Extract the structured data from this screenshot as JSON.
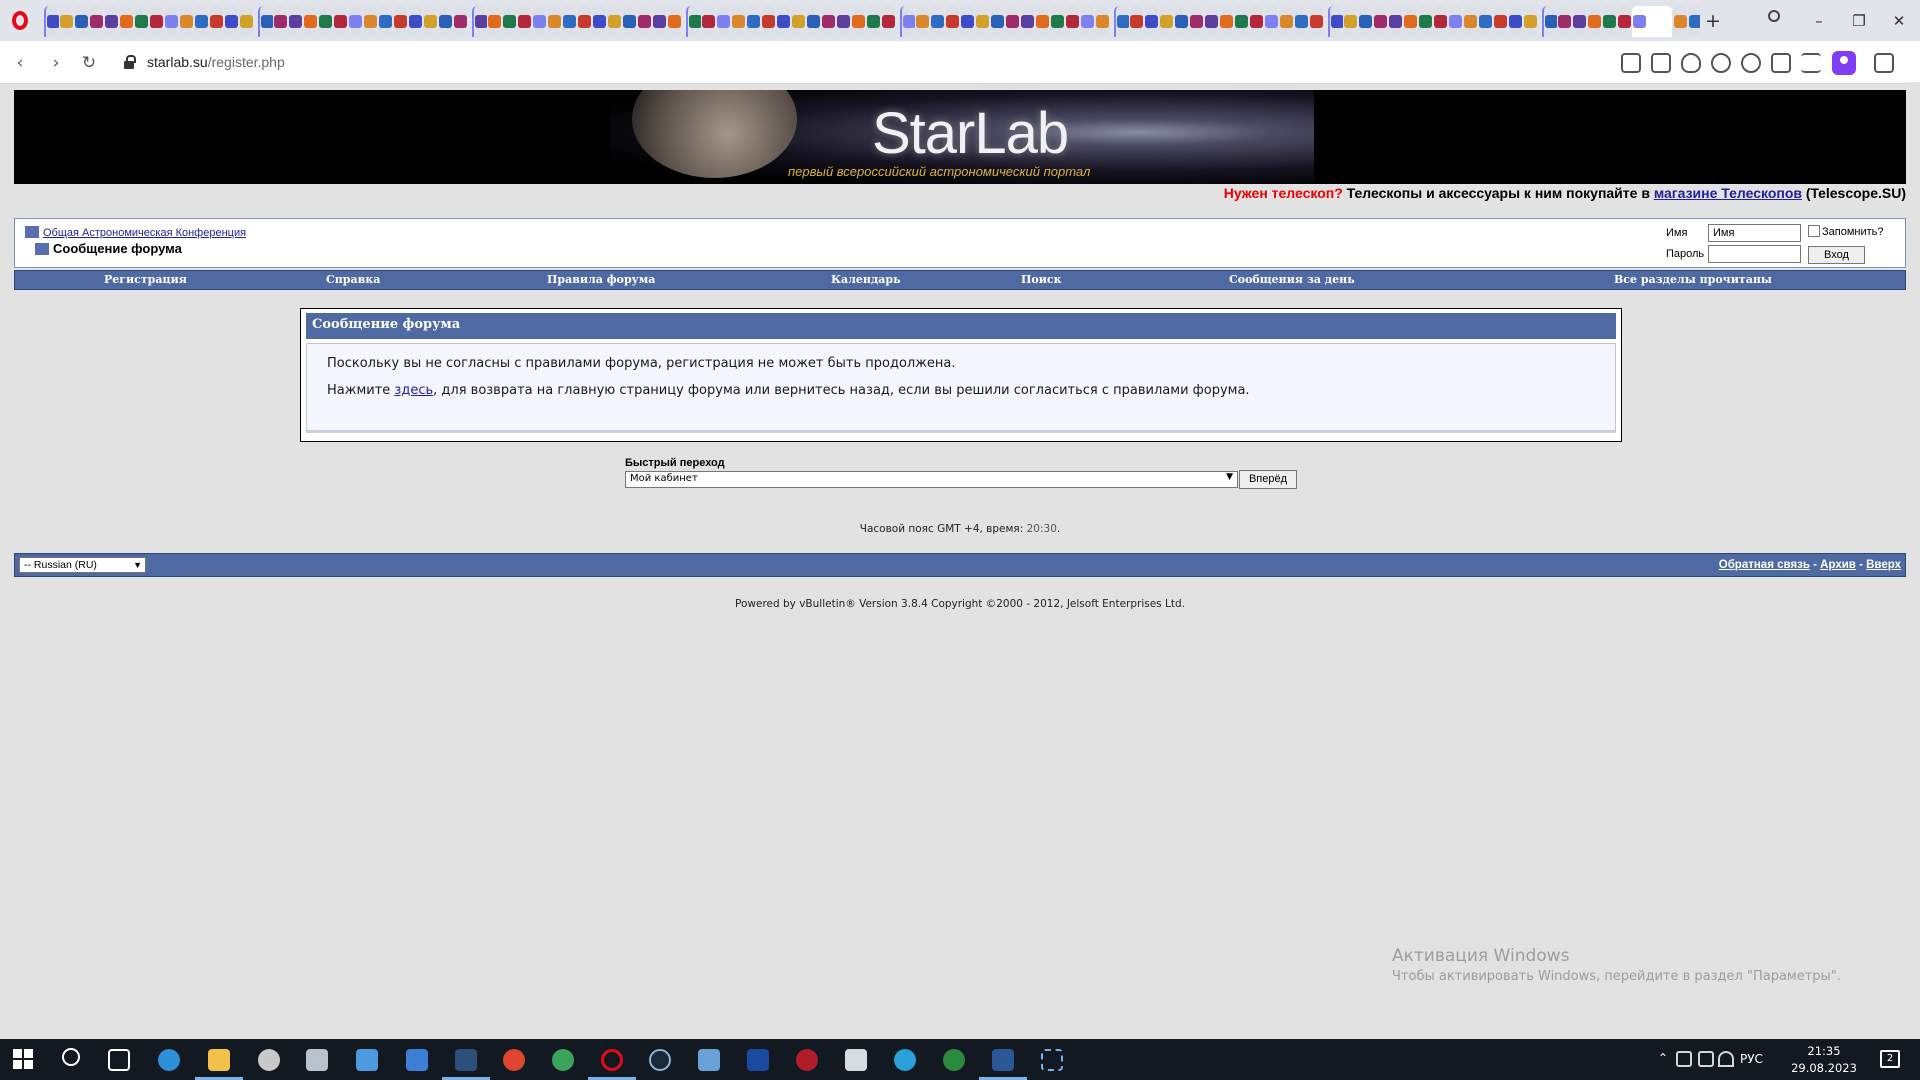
{
  "browser": {
    "url_host": "starlab.su",
    "url_path": "/register.php",
    "new_tab_label": "+",
    "window_buttons": {
      "minimize": "–",
      "restore": "❐",
      "close": "✕"
    },
    "nav": {
      "back": "‹",
      "forward": "›",
      "reload": "↻"
    }
  },
  "banner": {
    "logo": "StarLab",
    "tagline": "первый всероссийский астрономический портал",
    "promo_highlight": "Нужен телескоп?",
    "promo_text": " Телескопы и аксессуары к ним покупайте в ",
    "promo_link": "магазине Телескопов",
    "promo_suffix": " (Telescope.SU)"
  },
  "navbar": {
    "breadcrumb_link": "Общая Астрономическая Конференция",
    "page_title": "Сообщение форума",
    "login": {
      "username_label": "Имя",
      "username_value": "Имя",
      "password_label": "Пароль",
      "remember_label": "Запомнить?",
      "login_button": "Вход"
    }
  },
  "menu": [
    {
      "label": "Регистрация"
    },
    {
      "label": "Справка"
    },
    {
      "label": "Правила форума"
    },
    {
      "label": "Календарь"
    },
    {
      "label": "Поиск"
    },
    {
      "label": "Сообщения за день"
    },
    {
      "label": "Все разделы прочитаны"
    }
  ],
  "message": {
    "title": "Сообщение форума",
    "line1": "Поскольку вы не согласны с правилами форума, регистрация не может быть продолжена.",
    "line2_prefix": "Нажмите ",
    "line2_link": "здесь",
    "line2_suffix": ", для возврата на главную страницу форума или вернитесь назад, если вы решили согласиться с правилами форума."
  },
  "quick_jump": {
    "label": "Быстрый переход",
    "selected": "Мой кабинет",
    "go_button": "Вперёд"
  },
  "timezone": {
    "text": "Часовой пояс GMT +4, время: ",
    "time": "20:30",
    "suffix": "."
  },
  "footer": {
    "language": "-- Russian (RU)",
    "links": [
      "Обратная связь",
      "Архив",
      "Вверх"
    ],
    "separator": " - ",
    "copyright": "Powered by vBulletin® Version 3.8.4 Copyright ©2000 - 2012, Jelsoft Enterprises Ltd."
  },
  "windows_activation": {
    "title": "Активация Windows",
    "subtitle": "Чтобы активировать Windows, перейдите в раздел \"Параметры\"."
  },
  "taskbar": {
    "lang": "РУС",
    "time": "21:35",
    "date": "29.08.2023",
    "notifications": "2"
  },
  "colors": {
    "forum_blue": "#4f6aa2",
    "promo_red": "#e00000",
    "link_blue": "#22229c",
    "opera_red": "#e30b1b"
  }
}
